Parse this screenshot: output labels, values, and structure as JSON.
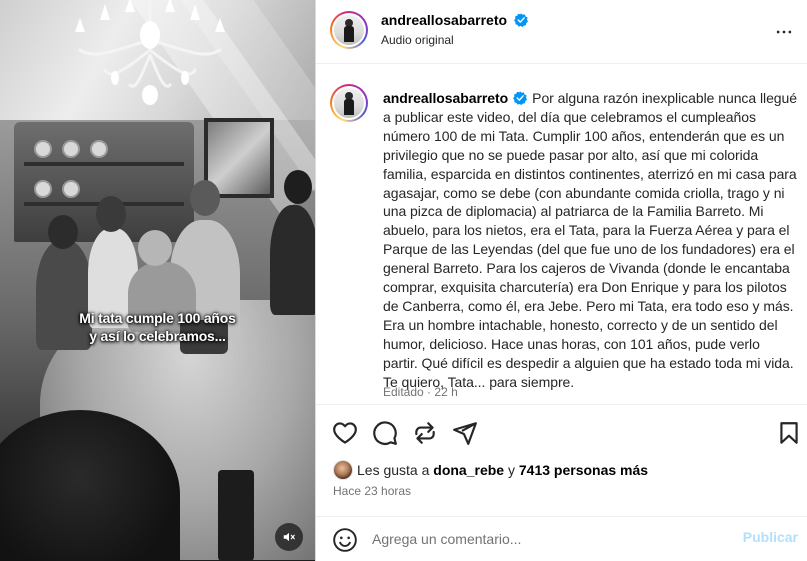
{
  "post": {
    "username": "andreallosabarreto",
    "verified": true,
    "audio_label": "Audio original"
  },
  "media": {
    "overlay_line1": "Mi tata cumple 100 años",
    "overlay_line2": "y así lo celebramos...",
    "mute_icon": "speaker-muted-icon"
  },
  "caption": {
    "username": "andreallosabarreto",
    "text": "Por alguna razón inexplicable nunca llegué a publicar este video, del día que celebramos el cumpleaños número 100 de mi Tata. Cumplir 100 años, entenderán que es un privilegio que no se puede pasar por alto, así que mi colorida familia, esparcida en distintos continentes, aterrizó en mi casa para agasajar, como se debe (con abundante comida criolla, trago y ni una pizca de diplomacia) al patriarca de la Familia Barreto. Mi abuelo, para los nietos, era el Tata, para la Fuerza Aérea y para el Parque de las Leyendas (del que fue uno de los fundadores) era el general Barreto. Para los cajeros de Vivanda (donde le encantaba comprar, exquisita charcutería) era Don Enrique y para los pilotos de Canberra, como él, era Jebe. Pero mi Tata, era todo eso y más. Era un hombre intachable, honesto, correcto y de un sentido del humor, delicioso. Hace unas horas, con 101 años, pude verlo partir. Qué difícil es despedir a alguien que ha estado toda mi vida. Te quiero, Tata... para siempre.",
    "edited": "Editado",
    "separator": "·",
    "time": "22 h"
  },
  "actions": {
    "like_icon": "heart-icon",
    "comment_icon": "comment-icon",
    "share_icon": "repost-icon",
    "send_icon": "send-icon",
    "save_icon": "bookmark-icon"
  },
  "likes": {
    "prefix": "Les gusta a",
    "first_user": "dona_rebe",
    "connector": "y",
    "others": "7413 personas más",
    "time_ago": "Hace 23 horas"
  },
  "comment": {
    "placeholder": "Agrega un comentario...",
    "post_label": "Publicar"
  },
  "colors": {
    "verified_blue": "#0095f6",
    "post_button_disabled": "#b2dffc",
    "secondary_text": "#737373",
    "divider": "#efefef"
  }
}
